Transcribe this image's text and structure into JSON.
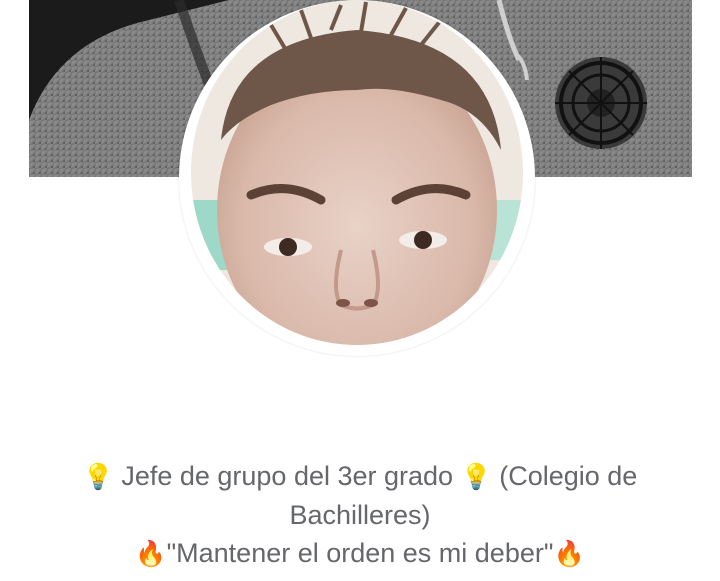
{
  "profile": {
    "cover_alt_icon": "cover-photo",
    "avatar_icon": "profile-picture",
    "bio": {
      "line1_emoji_left": "💡",
      "line1_text": "Jefe de grupo del 3er grado",
      "line1_emoji_right": "💡",
      "line1_suffix": "(Colegio de",
      "line2_text": "Bachilleres)",
      "line3_emoji_left": "🔥",
      "line3_text": "\"Mantener el orden es mi deber\"",
      "line3_emoji_right": "🔥"
    }
  },
  "colors": {
    "bio_text": "#65676b",
    "background": "#ffffff"
  }
}
